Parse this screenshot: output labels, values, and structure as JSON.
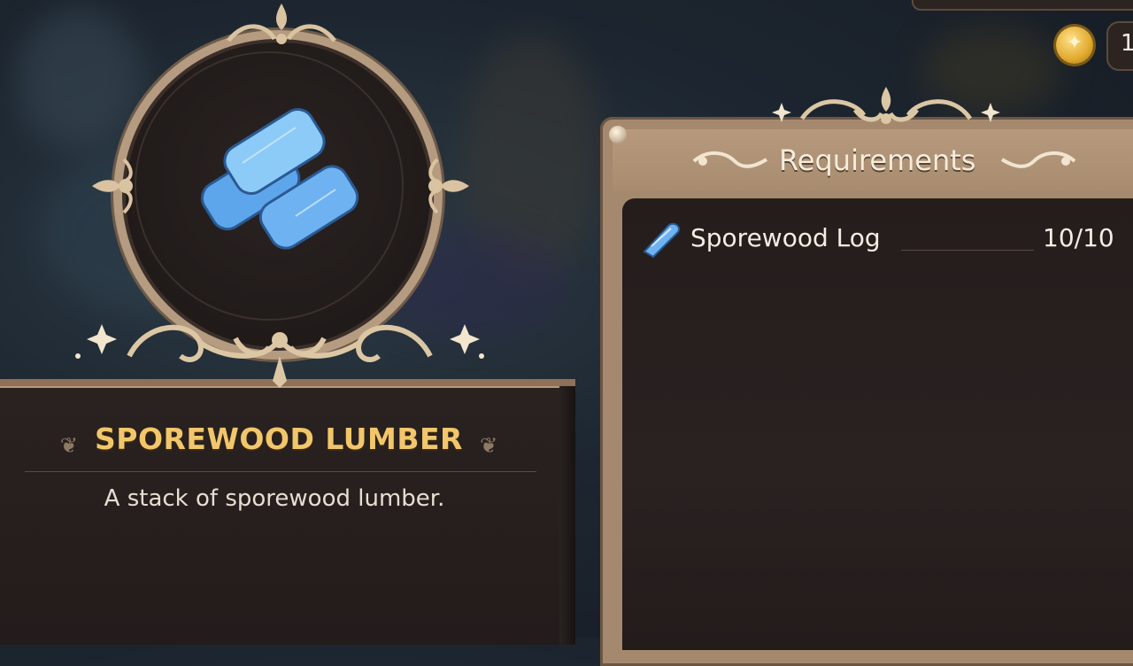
{
  "item": {
    "name": "SPOREWOOD LUMBER",
    "description": "A stack of sporewood lumber.",
    "icon": "blue-log-stack-icon"
  },
  "requirements": {
    "title": "Requirements",
    "items": [
      {
        "icon": "sporewood-log-icon",
        "name": "Sporewood Log",
        "count": "10/10"
      }
    ]
  },
  "currency": {
    "icon": "gold-coin-icon",
    "amount": "1"
  },
  "colors": {
    "title_gold": "#f2c66a",
    "frame_tan": "#a5896e",
    "panel_dark": "#241d1c",
    "item_blue": "#6fb2f2"
  }
}
